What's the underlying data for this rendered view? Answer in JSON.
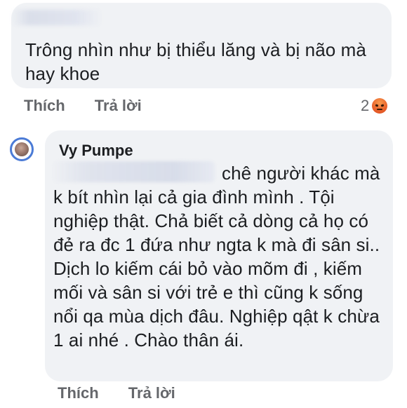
{
  "comments": [
    {
      "author": "",
      "text": "Trông nhìn như bị thiểu lăng và bị não mà hay khoe",
      "actions": {
        "like": "Thích",
        "reply": "Trả lời"
      },
      "reaction_count": "2",
      "reaction_icon": "angry-icon"
    },
    {
      "author": "Vy Pumpe",
      "text": "chê người khác mà k bít nhìn lại cả gia đình mình . Tội nghiệp thật. Chả biết cả dòng cả họ có đẻ ra đc 1 đứa như ngta k mà đi sân si.. Dịch lo kiếm cái bỏ vào mõm đi , kiếm mối và sân si với trẻ e thì cũng k sống nổi qa mùa dịch đâu. Nghiệp qật k chừa 1 ai nhé . Chào thân ái.",
      "actions": {
        "like": "Thích",
        "reply": "Trả lời"
      }
    }
  ],
  "colors": {
    "bubble_bg": "#f0f2f5",
    "action_text": "#65676b",
    "avatar_ring": "#4b7bd6",
    "angry_reaction": "#e9612b"
  }
}
